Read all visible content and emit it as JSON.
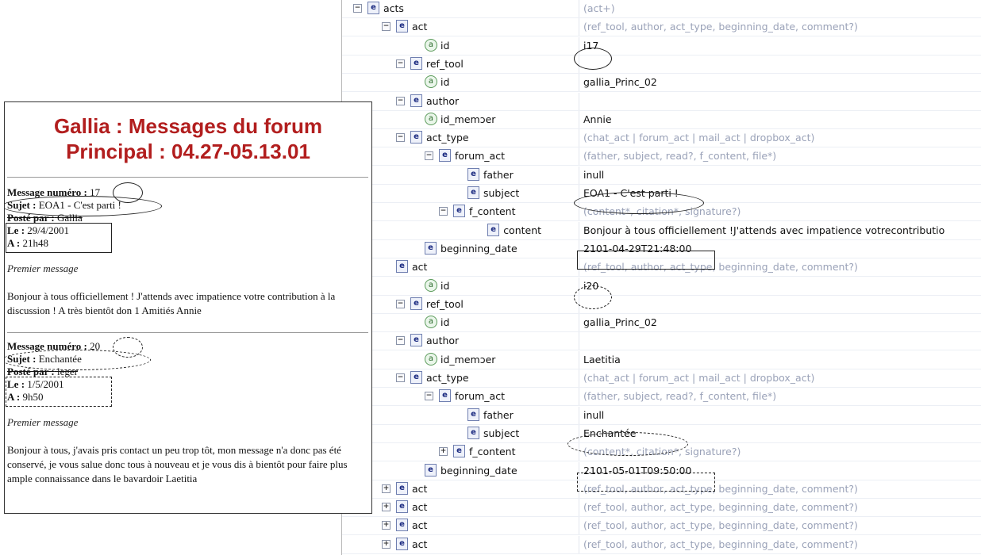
{
  "tree": {
    "rows": [
      {
        "lvl": 0,
        "tog": "−",
        "icon": "e",
        "label": "acts",
        "value": "(act+)",
        "model": true
      },
      {
        "lvl": 1,
        "tog": "−",
        "icon": "e",
        "label": "act",
        "value": "(ref_tool, author, act_type, beginning_date, comment?)",
        "model": true
      },
      {
        "lvl": 2,
        "tog": "",
        "icon": "a",
        "label": "id",
        "value": "i17",
        "model": false
      },
      {
        "lvl": 1.5,
        "tog": "−",
        "icon": "e",
        "label": "ref_tool",
        "value": "",
        "model": false
      },
      {
        "lvl": 2,
        "tog": "",
        "icon": "a",
        "label": "id",
        "value": "gallia_Princ_02",
        "model": false
      },
      {
        "lvl": 1.5,
        "tog": "−",
        "icon": "e",
        "label": "author",
        "value": "",
        "model": false
      },
      {
        "lvl": 2,
        "tog": "",
        "icon": "a",
        "label": "id_memɔer",
        "value": "Annie",
        "model": false
      },
      {
        "lvl": 1.5,
        "tog": "−",
        "icon": "e",
        "label": "act_type",
        "value": "(chat_act | forum_act | mail_act | dropbox_act)",
        "model": true
      },
      {
        "lvl": 2.5,
        "tog": "−",
        "icon": "e",
        "label": "forum_act",
        "value": "(father, subject, read?, f_content, file*)",
        "model": true
      },
      {
        "lvl": 3.5,
        "tog": "",
        "icon": "e",
        "label": "father",
        "value": "inull",
        "model": false
      },
      {
        "lvl": 3.5,
        "tog": "",
        "icon": "e",
        "label": "subject",
        "value": "EOA1 - C'est parti !",
        "model": false
      },
      {
        "lvl": 3,
        "tog": "−",
        "icon": "e",
        "label": "f_content",
        "value": "(content*, citation*, signature?)",
        "model": true
      },
      {
        "lvl": 4.2,
        "tog": "",
        "icon": "e",
        "label": "content",
        "value": "Bonjour à tous officiellement !J'attends avec impatience votrecontributio",
        "model": false
      },
      {
        "lvl": 2,
        "tog": "",
        "icon": "e",
        "label": "beginning_date",
        "value": "2101-04-29T21:48:00",
        "model": false
      },
      {
        "lvl": 1,
        "tog": "",
        "icon": "e",
        "label": "act",
        "value": "(ref_tool, author, act_type, beginning_date, comment?)",
        "model": true
      },
      {
        "lvl": 2,
        "tog": "",
        "icon": "a",
        "label": "id",
        "value": "i20",
        "model": false
      },
      {
        "lvl": 1.5,
        "tog": "−",
        "icon": "e",
        "label": "ref_tool",
        "value": "",
        "model": false
      },
      {
        "lvl": 2,
        "tog": "",
        "icon": "a",
        "label": "id",
        "value": "gallia_Princ_02",
        "model": false
      },
      {
        "lvl": 1.5,
        "tog": "−",
        "icon": "e",
        "label": "author",
        "value": "",
        "model": false
      },
      {
        "lvl": 2,
        "tog": "",
        "icon": "a",
        "label": "id_memɔer",
        "value": "Laetitia",
        "model": false
      },
      {
        "lvl": 1.5,
        "tog": "−",
        "icon": "e",
        "label": "act_type",
        "value": "(chat_act | forum_act | mail_act | dropbox_act)",
        "model": true
      },
      {
        "lvl": 2.5,
        "tog": "−",
        "icon": "e",
        "label": "forum_act",
        "value": "(father, subject, read?, f_content, file*)",
        "model": true
      },
      {
        "lvl": 3.5,
        "tog": "",
        "icon": "e",
        "label": "father",
        "value": "inull",
        "model": false
      },
      {
        "lvl": 3.5,
        "tog": "",
        "icon": "e",
        "label": "subject",
        "value": "Enchantée",
        "model": false
      },
      {
        "lvl": 3,
        "tog": "+",
        "icon": "e",
        "label": "f_content",
        "value": "(content*, citation*, signature?)",
        "model": true
      },
      {
        "lvl": 2,
        "tog": "",
        "icon": "e",
        "label": "beginning_date",
        "value": "2101-05-01T09:50:00",
        "model": false
      },
      {
        "lvl": 1,
        "tog": "+",
        "icon": "e",
        "label": "act",
        "value": "(ref_tool, author, act_type, beginning_date, comment?)",
        "model": true
      },
      {
        "lvl": 1,
        "tog": "+",
        "icon": "e",
        "label": "act",
        "value": "(ref_tool, author, act_type, beginning_date, comment?)",
        "model": true
      },
      {
        "lvl": 1,
        "tog": "+",
        "icon": "e",
        "label": "act",
        "value": "(ref_tool, author, act_type, beginning_date, comment?)",
        "model": true
      },
      {
        "lvl": 1,
        "tog": "+",
        "icon": "e",
        "label": "act",
        "value": "(ref_tool, author, act_type, beginning_date, comment?)",
        "model": true
      }
    ]
  },
  "forum": {
    "title_line1": "Gallia : Messages du forum",
    "title_line2": "Principal : 04.27-05.13.01",
    "msg1": {
      "numero_label": "Message numéro :",
      "numero": "17",
      "sujet_label": "Sujet :",
      "sujet": "EOA1 - C'est parti !",
      "poste_label": "Posté par :",
      "poste": "Gallia",
      "le_label": "Le :",
      "le": "29/4/2001",
      "a_label": "A :",
      "a": "21h48",
      "kind": "Premier message",
      "body": "Bonjour à tous officiellement ! J'attends avec impatience votre contribution à la discussion ! A très bientôt don 1 Amitiés Annie"
    },
    "msg2": {
      "numero_label": "Message numéro :",
      "numero": "20",
      "sujet_label": "Sujet :",
      "sujet": "Enchantée",
      "poste_label": "Posté par :",
      "poste": "leger",
      "le_label": "Le :",
      "le": "1/5/2001",
      "a_label": "A :",
      "a": "9h50",
      "kind": "Premier message",
      "body": "Bonjour à tous, j'avais pris contact un peu trop tôt, mon message n'a donc pas été conservé, je vous salue donc tous à nouveau et je vous dis à bientôt pour faire plus ample connaissance dans le bavardoir Laetitia"
    }
  }
}
